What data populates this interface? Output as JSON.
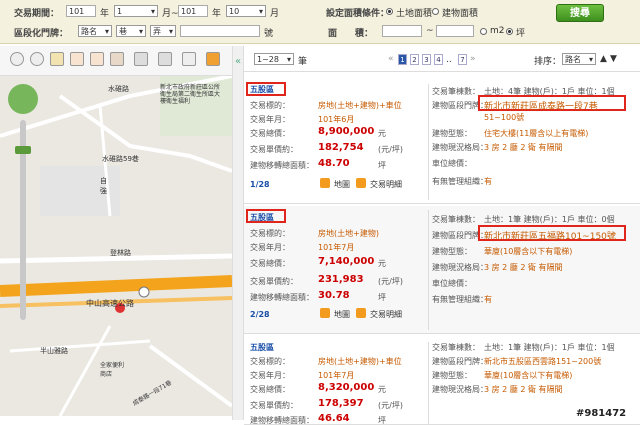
{
  "search": {
    "period_label": "交易期間：",
    "year_from": "101",
    "year_unit": "年",
    "month_from": "1",
    "month_sep": "月~",
    "year_to": "101",
    "year_to_unit": "年",
    "month_to": "10",
    "month_to_unit": "月",
    "area_setting_label": "設定面積條件：",
    "area_opt1": "土地面積",
    "area_opt2": "建物面積",
    "search_button": "搜尋",
    "address_label": "區段化門牌：",
    "road_select": "路名",
    "lane_select": "巷",
    "alley_select": "弄",
    "number_unit": "號",
    "size_label": "面　　積：",
    "size_sep": "~",
    "unit_m2": "m2",
    "unit_ping": "坪"
  },
  "map": {
    "labels": [
      "水碓路",
      "水碓路59巷",
      "自強",
      "登林路",
      "中山高速公路",
      "半山雅路",
      "全家便利商店",
      "成泰路一段71巷"
    ],
    "poi_text": "新北市政府新莊區公所衛生局第二衛生所區大樓衛生福利"
  },
  "list": {
    "range_select": "1~28",
    "range_unit": "筆",
    "pages": [
      "1",
      "2",
      "3",
      "4",
      "7"
    ],
    "sort_label": "排序：",
    "sort_select": "路名"
  },
  "cards": [
    {
      "district": "五股區",
      "type_k": "交易標的：",
      "type_v": "房地(土地+建物)+車位",
      "date_k": "交易年月：",
      "date_v": "101年6月",
      "total_k": "交易總價：",
      "total_v": "8,900,000",
      "total_u": "元",
      "unit_k": "交易單價約：",
      "unit_v": "182,754",
      "unit_u": "(元/坪)",
      "area_k": "建物移轉總面積：",
      "area_v": "48.70",
      "area_u": "坪",
      "index": "1/28",
      "map_link": "地圖",
      "detail_link": "交易明細",
      "r_count_k": "交易筆棟數：",
      "r_count_v": "土地：4筆 建物(戶)：1戶 車位：1個",
      "r_addr_k": "建物區段門牌：",
      "r_addr_v": "新北市新莊區成泰路一段7巷",
      "r_addr_v2": "51~100號",
      "r_type_k": "建物型態：",
      "r_type_v": "住宅大樓(11層含以上有電梯)",
      "r_layout_k": "建物現況格局：",
      "r_layout_v": "3 房 2 廳 2 衛 有隔間",
      "r_park_k": "車位總價：",
      "r_park_v": "",
      "r_mgmt_k": "有無管理組織：",
      "r_mgmt_v": "有"
    },
    {
      "district": "五股區",
      "type_k": "交易標的：",
      "type_v": "房地(土地+建物)",
      "date_k": "交易年月：",
      "date_v": "101年7月",
      "total_k": "交易總價：",
      "total_v": "7,140,000",
      "total_u": "元",
      "unit_k": "交易單價約：",
      "unit_v": "231,983",
      "unit_u": "(元/坪)",
      "area_k": "建物移轉總面積：",
      "area_v": "30.78",
      "area_u": "坪",
      "index": "2/28",
      "map_link": "地圖",
      "detail_link": "交易明細",
      "r_count_k": "交易筆棟數：",
      "r_count_v": "土地：1筆 建物(戶)：1戶 車位：0個",
      "r_addr_k": "建物區段門牌：",
      "r_addr_v": "新北市新莊區五福路101~150號",
      "r_type_k": "建物型態：",
      "r_type_v": "華廈(10層含以下有電梯)",
      "r_layout_k": "建物現況格局：",
      "r_layout_v": "3 房 2 廳 2 衛 有隔間",
      "r_park_k": "車位總價：",
      "r_park_v": "",
      "r_mgmt_k": "有無管理組織：",
      "r_mgmt_v": "有"
    },
    {
      "district": "五股區",
      "type_k": "交易標的：",
      "type_v": "房地(土地+建物)+車位",
      "date_k": "交易年月：",
      "date_v": "101年7月",
      "total_k": "交易總價：",
      "total_v": "8,320,000",
      "total_u": "元",
      "unit_k": "交易單價約：",
      "unit_v": "178,397",
      "unit_u": "(元/坪)",
      "area_k": "建物移轉總面積：",
      "area_v": "46.64",
      "area_u": "坪",
      "r_count_k": "交易筆棟數：",
      "r_count_v": "土地：1筆 建物(戶)：1戶 車位：1個",
      "r_addr_k": "建物區段門牌：",
      "r_addr_v": "新北市五股區西雲路151~200號",
      "r_type_k": "建物型態：",
      "r_type_v": "華廈(10層含以下有電梯)",
      "r_layout_k": "建物現況格局：",
      "r_layout_v": "3 房 2 廳 2 衛 有隔間"
    }
  ],
  "watermark": "#981472"
}
